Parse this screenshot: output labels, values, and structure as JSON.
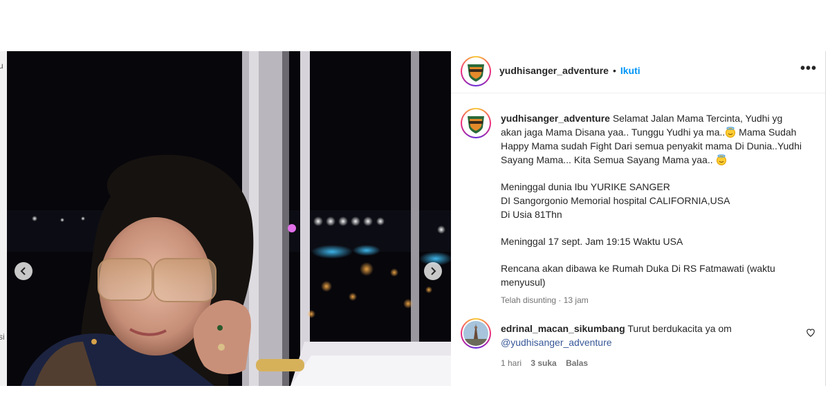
{
  "media": {
    "prev_peek_chars": [
      "u",
      "si"
    ],
    "prev_button": "previous-image",
    "next_button": "next-image"
  },
  "header": {
    "username": "yudhisanger_adventure",
    "separator": "•",
    "follow_label": "Ikuti",
    "more_label": "•••"
  },
  "caption": {
    "username": "yudhisanger_adventure",
    "line1": " Selamat Jalan Mama Tercinta, Yudhi yg akan jaga Mama Disana yaa.. Tunggu Yudhi ya ma..",
    "line1b": " Mama Sudah Happy Mama sudah Fight Dari semua penyakit mama Di Dunia..Yudhi Sayang Mama... Kita Semua Sayang Mama yaa.. ",
    "para2_l1": "Meninggal dunia Ibu YURIKE SANGER",
    "para2_l2": "DI Sangorgonio Memorial hospital CALIFORNIA,USA",
    "para2_l3": "Di Usia 81Thn",
    "para3": "Meninggal 17 sept. Jam 19:15 Waktu USA",
    "para4": "Rencana akan dibawa ke Rumah Duka Di RS Fatmawati (waktu menyusul)",
    "edited": "Telah disunting",
    "edited_sep": " · ",
    "time": "13 jam"
  },
  "comment": {
    "username": "edrinal_macan_sikumbang",
    "text": " Turut berdukacita ya om ",
    "mention": "@yudhisanger_adventure",
    "time": "1 hari",
    "likes": "3 suka",
    "reply": "Balas"
  },
  "colors": {
    "follow": "#0095f6",
    "muted": "#737373",
    "text": "#262626"
  },
  "icons": {
    "prev": "chevron-left-icon",
    "next": "chevron-right-icon",
    "heart": "heart-outline-icon",
    "emoji": "smiling-face-with-halo-emoji"
  }
}
